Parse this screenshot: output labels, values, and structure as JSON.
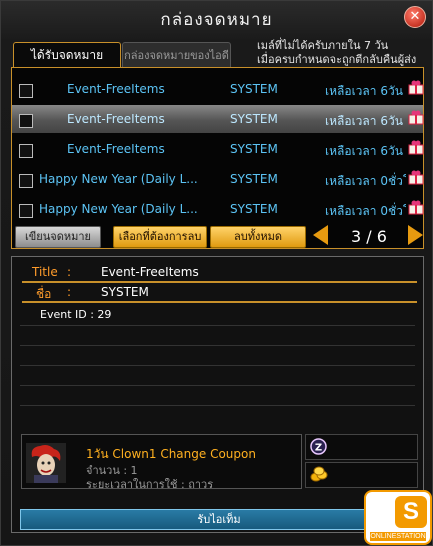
{
  "window": {
    "title": "กล่องจดหมาย"
  },
  "tabs": {
    "inbox": "ได้รับจดหมาย",
    "id_mail": "กล่องจดหมายของไอดี"
  },
  "notice": {
    "line1": "เมล์ที่ไม่ได้ครับภายใน 7 วัน",
    "line2": "เมื่อครบกำหนดจะถูกตีกลับคืนผู้ส่ง"
  },
  "mails": [
    {
      "subject": "Event-FreeItems",
      "sender": "SYSTEM",
      "time": "เหลือเวลา 6วัน",
      "checkbox": true
    },
    {
      "subject": "Event-FreeItems",
      "sender": "SYSTEM",
      "time": "เหลือเวลา 6วัน",
      "checkbox": true,
      "selected": true
    },
    {
      "subject": "Event-FreeItems",
      "sender": "SYSTEM",
      "time": "เหลือเวลา 6วัน",
      "checkbox": true
    },
    {
      "subject": "Happy New Year (Daily L...",
      "sender": "SYSTEM",
      "time": "เหลือเวลา 0ชั่วโมง",
      "checkbox": true
    },
    {
      "subject": "Happy New Year (Daily L...",
      "sender": "SYSTEM",
      "time": "เหลือเวลา 0ชั่วโมง",
      "checkbox": true
    }
  ],
  "buttons": {
    "write": "เขียนจดหมาย",
    "delete_selected": "เลือกที่ต้องการลบ",
    "delete_all": "ลบทั้งหมด"
  },
  "pagination": {
    "current": "3 / 6"
  },
  "detail": {
    "title_label": "Title",
    "title_sep": ":",
    "title_value": "Event-FreeItems",
    "from_label": "ชื่อ",
    "from_sep": ":",
    "from_value": "SYSTEM",
    "body": "Event ID : 29"
  },
  "attachment": {
    "name": "1วัน Clown1 Change Coupon",
    "qty": "จำนวน : 1",
    "duration": "ระยะเวลาในการใช้ : ถาวร"
  },
  "claim_button": "รับไอเท็ม",
  "logo": {
    "letter": "S",
    "text": "ONLINESTATION"
  },
  "colors": {
    "accent": "#c8902a",
    "link": "#5cc4f5",
    "gold": "#e69a10"
  }
}
